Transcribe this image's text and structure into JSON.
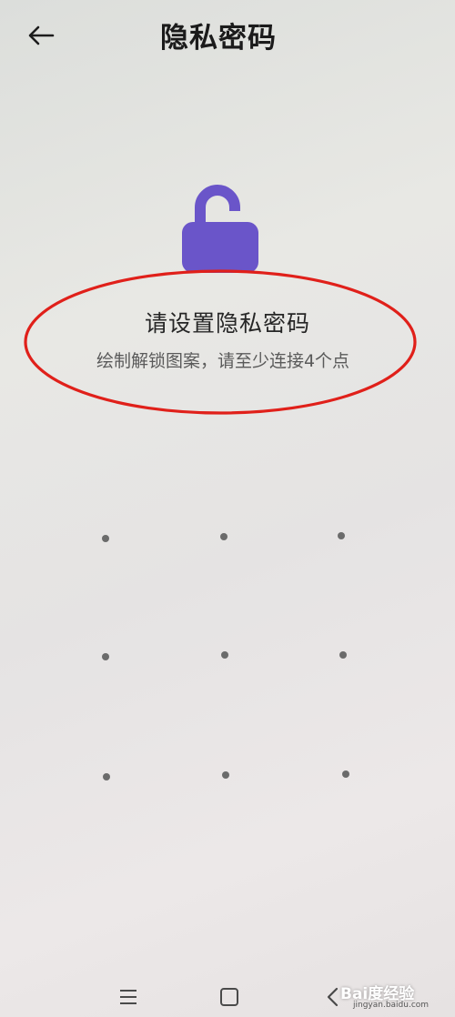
{
  "header": {
    "title": "隐私密码",
    "back_icon": "arrow-left-icon"
  },
  "lock": {
    "icon": "unlocked-padlock-icon",
    "color": "#6a55c9"
  },
  "prompt": {
    "title": "请设置隐私密码",
    "hint": "绘制解锁图案，请至少连接4个点"
  },
  "annotation": {
    "color": "#e0201a"
  },
  "pattern": {
    "dots": [
      {
        "row": 1,
        "col": 1
      },
      {
        "row": 1,
        "col": 2
      },
      {
        "row": 1,
        "col": 3
      },
      {
        "row": 2,
        "col": 1
      },
      {
        "row": 2,
        "col": 2
      },
      {
        "row": 2,
        "col": 3
      },
      {
        "row": 3,
        "col": 1
      },
      {
        "row": 3,
        "col": 2
      },
      {
        "row": 3,
        "col": 3
      }
    ]
  },
  "navbar": {
    "menu_icon": "menu-icon",
    "home_icon": "home-square-icon",
    "back_icon": "back-triangle-icon"
  },
  "watermark": {
    "text": "Bai度经验",
    "url": "jingyan.baidu.com"
  }
}
